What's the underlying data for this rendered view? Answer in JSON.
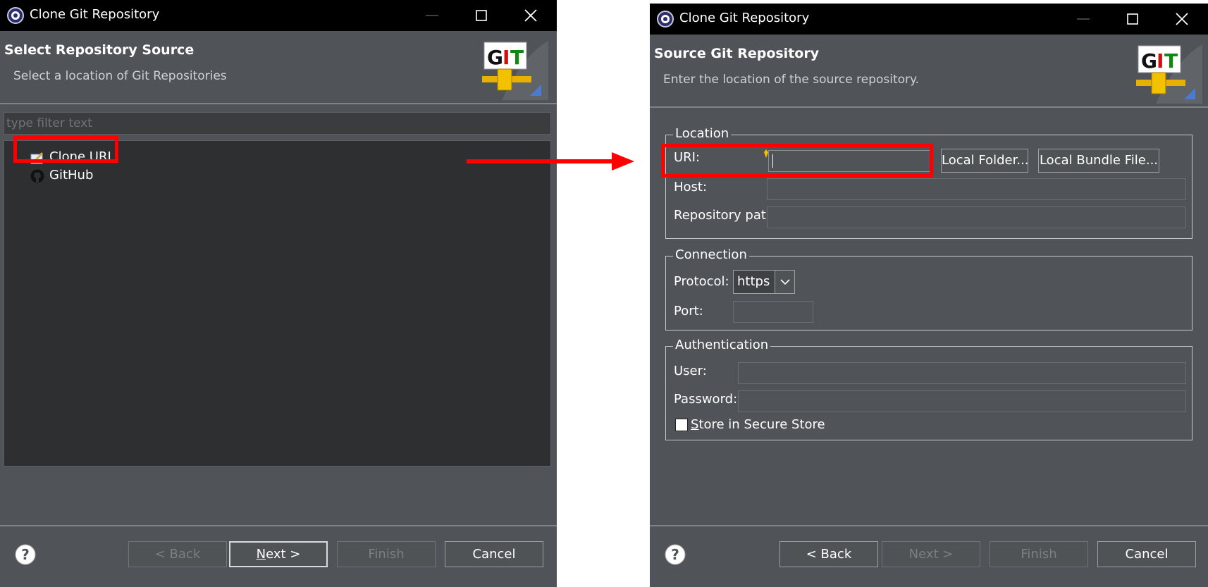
{
  "dialog1": {
    "window_title": "Clone Git Repository",
    "header_title": "Select Repository Source",
    "header_description": "Select a location of Git Repositories",
    "logo_text": "GIT",
    "filter_placeholder": "type filter text",
    "tree_items": [
      {
        "label": "Clone URI",
        "icon": "clone-uri-icon",
        "highlighted": true
      },
      {
        "label": "GitHub",
        "icon": "github-icon",
        "highlighted": false
      }
    ],
    "buttons": {
      "back": "< Back",
      "next": "Next >",
      "finish": "Finish",
      "cancel": "Cancel"
    }
  },
  "dialog2": {
    "window_title": "Clone Git Repository",
    "header_title": "Source Git Repository",
    "header_description": "Enter the location of the source repository.",
    "logo_text": "GIT",
    "location": {
      "group_title": "Location",
      "uri_label": "URI:",
      "uri_value": "",
      "host_label": "Host:",
      "repo_path_label": "Repository path:",
      "local_folder_button": "Local Folder...",
      "local_bundle_button": "Local Bundle File..."
    },
    "connection": {
      "group_title": "Connection",
      "protocol_label": "Protocol:",
      "protocol_value": "https",
      "port_label": "Port:"
    },
    "authentication": {
      "group_title": "Authentication",
      "user_label": "User:",
      "password_label": "Password:",
      "store_label": "Store in Secure Store",
      "store_checked": false
    },
    "buttons": {
      "back": "< Back",
      "next": "Next >",
      "finish": "Finish",
      "cancel": "Cancel"
    }
  },
  "colors": {
    "dialog_bg": "#505458",
    "titlebar_bg": "#000000",
    "highlight_red": "#ff0000",
    "tree_bg": "#2e2f30"
  }
}
